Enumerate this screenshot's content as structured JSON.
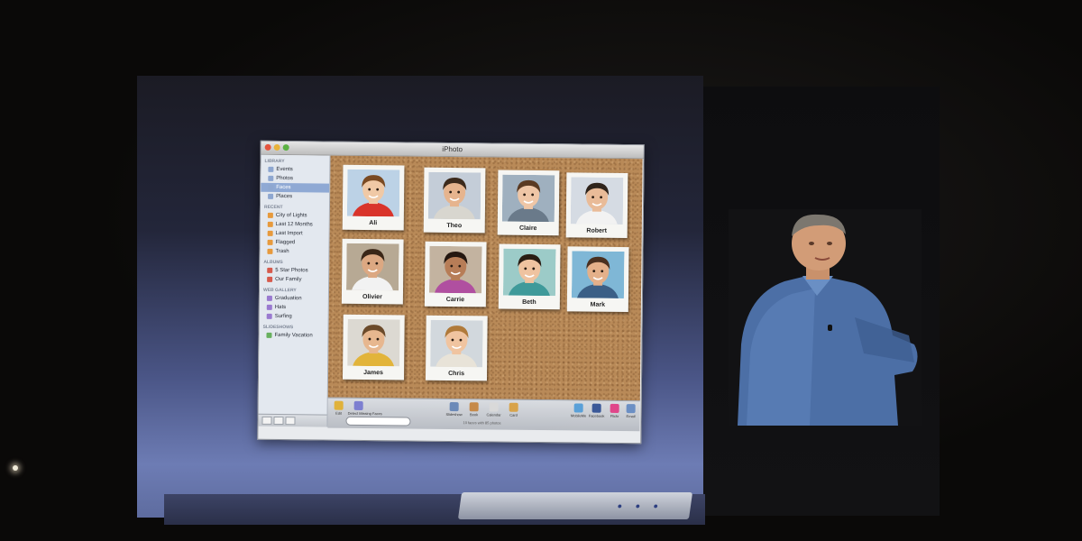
{
  "app": {
    "window_title": "iPhoto"
  },
  "sidebar": {
    "sections": [
      {
        "heading": "LIBRARY",
        "items": [
          {
            "label": "Events",
            "icon": "events-icon",
            "selected": false
          },
          {
            "label": "Photos",
            "icon": "photos-icon",
            "selected": false
          },
          {
            "label": "Faces",
            "icon": "faces-icon",
            "selected": true
          },
          {
            "label": "Places",
            "icon": "places-icon",
            "selected": false
          }
        ]
      },
      {
        "heading": "RECENT",
        "items": [
          {
            "label": "City of Lights",
            "icon": "event-icon",
            "selected": false
          },
          {
            "label": "Last 12 Months",
            "icon": "calendar-icon",
            "selected": false
          },
          {
            "label": "Last Import",
            "icon": "import-icon",
            "selected": false
          },
          {
            "label": "Flagged",
            "icon": "flag-icon",
            "selected": false
          },
          {
            "label": "Trash",
            "icon": "trash-icon",
            "selected": false
          }
        ]
      },
      {
        "heading": "ALBUMS",
        "items": [
          {
            "label": "5 Star Photos",
            "icon": "smart-album-icon",
            "selected": false
          },
          {
            "label": "Our Family",
            "icon": "album-icon",
            "selected": false
          }
        ]
      },
      {
        "heading": "WEB GALLERY",
        "items": [
          {
            "label": "Graduation",
            "icon": "web-gallery-icon",
            "selected": false
          },
          {
            "label": "Hats",
            "icon": "web-gallery-icon",
            "selected": false
          },
          {
            "label": "Surfing",
            "icon": "web-gallery-icon",
            "selected": false
          }
        ]
      },
      {
        "heading": "SLIDESHOWS",
        "items": [
          {
            "label": "Family Vacation",
            "icon": "slideshow-icon",
            "selected": false
          }
        ]
      }
    ]
  },
  "faces": [
    {
      "name": "Ali",
      "skin": "#f0c9a6",
      "hair": "#7a4a22",
      "shirt": "#d9342b",
      "bg": "#bcd2e6"
    },
    {
      "name": "Theo",
      "skin": "#e6b48e",
      "hair": "#3c2a1c",
      "shirt": "#d8d6cf",
      "bg": "#c4cdd8"
    },
    {
      "name": "Claire",
      "skin": "#efc6a6",
      "hair": "#5a3a22",
      "shirt": "#6a7a8a",
      "bg": "#9fb0bf"
    },
    {
      "name": "Robert",
      "skin": "#e9bb98",
      "hair": "#2f241b",
      "shirt": "#f2f2f2",
      "bg": "#d5dbe3"
    },
    {
      "name": "Olivier",
      "skin": "#dca882",
      "hair": "#3a2617",
      "shirt": "#f2f2f2",
      "bg": "#b7a994"
    },
    {
      "name": "Carrie",
      "skin": "#b77d57",
      "hair": "#241710",
      "shirt": "#b04fa0",
      "bg": "#c3b3a0"
    },
    {
      "name": "Beth",
      "skin": "#efc3a0",
      "hair": "#2a1d14",
      "shirt": "#3f9a9a",
      "bg": "#9ccbc8"
    },
    {
      "name": "Mark",
      "skin": "#e4b08a",
      "hair": "#4a3020",
      "shirt": "#3b5f86",
      "bg": "#7fb7d6"
    },
    {
      "name": "James",
      "skin": "#e7b78f",
      "hair": "#6b4a2a",
      "shirt": "#e2b43a",
      "bg": "#dcd9d2"
    },
    {
      "name": "Chris",
      "skin": "#f0c4a0",
      "hair": "#b07a3a",
      "shirt": "#e8e3d8",
      "bg": "#d2d8dd"
    }
  ],
  "toolbar": {
    "left_buttons": [
      {
        "label": "Edit",
        "icon": "edit-icon",
        "color": "#e0b23b"
      },
      {
        "label": "Detect Missing Faces",
        "icon": "faces-detect-icon",
        "color": "#7d7fd0"
      }
    ],
    "center_buttons": [
      {
        "label": "Slideshow",
        "icon": "slideshow-icon",
        "color": "#6c8ab8"
      },
      {
        "label": "Book",
        "icon": "book-icon",
        "color": "#c68a4a"
      },
      {
        "label": "Calendar",
        "icon": "calendar-icon",
        "color": "#d9d9d9"
      },
      {
        "label": "Card",
        "icon": "card-icon",
        "color": "#d8a34a"
      }
    ],
    "right_buttons": [
      {
        "label": "MobileMe",
        "icon": "mobileme-icon",
        "color": "#5aa0d8"
      },
      {
        "label": "Facebook",
        "icon": "facebook-icon",
        "color": "#3b5998"
      },
      {
        "label": "Flickr",
        "icon": "flickr-icon",
        "color": "#e0468a"
      },
      {
        "label": "Email",
        "icon": "email-icon",
        "color": "#6b8fc4"
      }
    ],
    "count_text": "10 faces with 85 photos"
  },
  "colors": {
    "selection": "#8fa9d4",
    "cork": "#b98a58",
    "screen_blue": "#6d7cb4"
  }
}
